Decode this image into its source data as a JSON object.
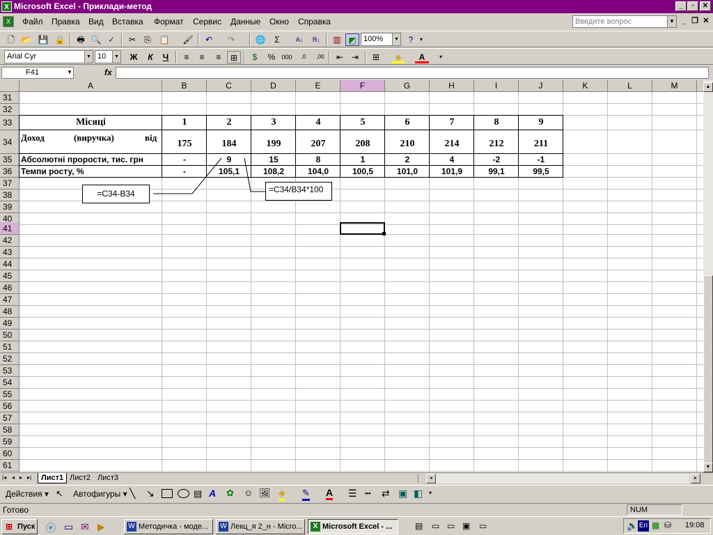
{
  "window": {
    "title": "Microsoft Excel - Приклади-метод",
    "min": "_",
    "max": "▫",
    "close": "✕"
  },
  "menu": [
    "Файл",
    "Правка",
    "Вид",
    "Вставка",
    "Формат",
    "Сервис",
    "Данные",
    "Окно",
    "Справка"
  ],
  "ask": {
    "placeholder": "Введите вопрос"
  },
  "toolbar": {
    "zoom": "100%",
    "font": "Arial Cyr",
    "size": "10",
    "bold": "Ж",
    "italic": "К",
    "underline": "Ч",
    "percent": "%",
    "thousands": "000"
  },
  "formula_bar": {
    "cell_ref": "F41",
    "fx": "fx",
    "content": ""
  },
  "columns": [
    "A",
    "B",
    "C",
    "D",
    "E",
    "F",
    "G",
    "H",
    "I",
    "J",
    "K",
    "L",
    "M"
  ],
  "rows": [
    "31",
    "32",
    "33",
    "34",
    "35",
    "36",
    "37",
    "38",
    "39",
    "40",
    "41",
    "42",
    "43",
    "44",
    "45",
    "46",
    "47",
    "48",
    "49",
    "50",
    "51",
    "52",
    "53",
    "54",
    "55",
    "56",
    "57",
    "58",
    "59",
    "60",
    "61"
  ],
  "selected": {
    "column": "F",
    "row": "41"
  },
  "table": {
    "r33": {
      "label": "Місяці",
      "values": [
        "1",
        "2",
        "3",
        "4",
        "5",
        "6",
        "7",
        "8",
        "9"
      ]
    },
    "r34": {
      "label_parts": [
        "Доход",
        "(виручка)",
        "від"
      ],
      "values": [
        "175",
        "184",
        "199",
        "207",
        "208",
        "210",
        "214",
        "212",
        "211"
      ]
    },
    "r35": {
      "label": "Абсолютні прорости, тис. грн",
      "values": [
        "-",
        "9",
        "15",
        "8",
        "1",
        "2",
        "4",
        "-2",
        "-1"
      ]
    },
    "r36": {
      "label": "Темпи росту, %",
      "values": [
        "-",
        "105,1",
        "108,2",
        "104,0",
        "100,5",
        "101,0",
        "101,9",
        "99,1",
        "99,5"
      ]
    }
  },
  "notes": {
    "note1": "=C34-B34",
    "note2": "=C34/B34*100"
  },
  "sheets": [
    "Лист1",
    "Лист2",
    "Лист3"
  ],
  "drawing": {
    "actions": "Действия",
    "autoshapes": "Автофигуры"
  },
  "status": {
    "ready": "Готово",
    "num": "NUM"
  },
  "taskbar": {
    "start": "Пуск",
    "buttons": [
      "Методичка - моде...",
      "Лекц_я 2_н - Micro...",
      "Microsoft Excel - ..."
    ],
    "lang": "En",
    "clock": "19:08"
  },
  "colors": {
    "titlebar": "#800080",
    "selection_header": "#d8b0d8",
    "excel_green": "#1f7a1f"
  }
}
